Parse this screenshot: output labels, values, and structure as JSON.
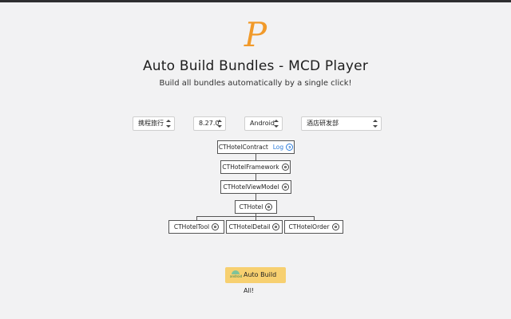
{
  "header": {
    "logo_letter": "P",
    "title": "Auto Build Bundles - MCD Player",
    "subtitle": "Build all bundles automatically by a single click!"
  },
  "selects": {
    "company": "携程旅行",
    "version": "8.27.0",
    "platform": "Android",
    "department": "酒店研发部"
  },
  "tree": {
    "contract": "CTHotelContract",
    "log_label": "Log",
    "framework": "CTHotelFramework",
    "viewmodel": "CTHotelViewModel",
    "hotel": "CTHotel",
    "tool": "CTHotelTool",
    "detail": "CTHotelDetail",
    "order": "CTHotelOrder"
  },
  "build_button": {
    "platform_badge": "android",
    "label": "Auto Build All!"
  },
  "colors": {
    "logo": "#f19a2a",
    "button": "#f7d070",
    "link": "#2f7ddb",
    "android": "#7fc39a"
  }
}
